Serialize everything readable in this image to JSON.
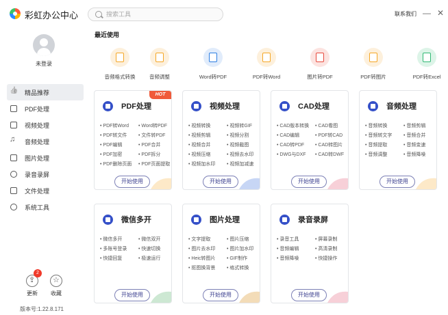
{
  "app": {
    "title": "彩虹办公中心"
  },
  "search": {
    "placeholder": "搜索工具"
  },
  "window": {
    "contact": "联系我们",
    "minimize": "—",
    "close": "✕"
  },
  "user": {
    "status": "未登录"
  },
  "sidebar": {
    "items": [
      {
        "label": "精品推荐",
        "icon": "thumbs-up-icon",
        "active": true
      },
      {
        "label": "PDF处理",
        "icon": "pdf-icon"
      },
      {
        "label": "视频处理",
        "icon": "video-icon"
      },
      {
        "label": "音频处理",
        "icon": "music-note-icon"
      },
      {
        "label": "图片处理",
        "icon": "image-icon"
      },
      {
        "label": "录音录屏",
        "icon": "record-icon"
      },
      {
        "label": "文件处理",
        "icon": "folder-icon"
      },
      {
        "label": "系统工具",
        "icon": "system-icon"
      }
    ],
    "update": {
      "label": "更新",
      "badge": "2"
    },
    "favorites": {
      "label": "收藏"
    },
    "version": "版本号:1.22.8.171"
  },
  "recent": {
    "title": "最近使用",
    "items": [
      {
        "label": "音频格式转换",
        "color": "#f5a623",
        "bg": "#fdf0dc"
      },
      {
        "label": "音频调整",
        "color": "#f5a623",
        "bg": "#fdf0dc"
      },
      {
        "label": "Word转PDF",
        "color": "#2a7de1",
        "bg": "#e1ecfb"
      },
      {
        "label": "PDF转Word",
        "color": "#f5a623",
        "bg": "#fdf0dc"
      },
      {
        "label": "图片转PDF",
        "color": "#e8473a",
        "bg": "#fce3e0"
      },
      {
        "label": "PDF转图片",
        "color": "#f5a623",
        "bg": "#fdf0dc"
      },
      {
        "label": "PDF转Excel",
        "color": "#2eb872",
        "bg": "#ddf4e8"
      }
    ]
  },
  "cards": [
    {
      "title": "PDF处理",
      "hot": "HOT",
      "color": "#3550c8",
      "features": [
        "PDF转Word",
        "Word转PDF",
        "PDF转文件",
        "文件转PDF",
        "PDF编辑",
        "PDF合并",
        "PDF加密",
        "PDF拆分",
        "PDF删除页面",
        "PDF页面提取"
      ],
      "button": "开始使用"
    },
    {
      "title": "视频处理",
      "color": "#3550c8",
      "features": [
        "视频转换",
        "视频转GIF",
        "视频剪辑",
        "视频分割",
        "视频合并",
        "视频截图",
        "视频压缩",
        "视频去水印",
        "视频加水印",
        "视频加减速"
      ],
      "button": "开始使用"
    },
    {
      "title": "CAD处理",
      "color": "#3550c8",
      "features": [
        "CAD版本转换",
        "CAD看图",
        "CAD编辑",
        "PDF转CAD",
        "CAD转PDF",
        "CAD转图片",
        "DWG与DXF",
        "CAD转DWF"
      ],
      "button": "开始使用"
    },
    {
      "title": "音频处理",
      "color": "#3550c8",
      "features": [
        "音频转换",
        "音频剪辑",
        "音频转文字",
        "音频合并",
        "音频提取",
        "音频变速",
        "音频调整",
        "音频降噪"
      ],
      "button": "开始使用"
    },
    {
      "title": "微信多开",
      "color": "#3550c8",
      "features": [
        "微信多开",
        "微信双开",
        "多账号登录",
        "快速切换",
        "快捷回复",
        "极速运行"
      ],
      "button": "开始使用"
    },
    {
      "title": "图片处理",
      "color": "#3550c8",
      "features": [
        "文字提取",
        "图片压缩",
        "图片去水印",
        "图片加水印",
        "Heic转图片",
        "GIF制作",
        "抠图换背景",
        "格式转换"
      ],
      "button": "开始使用"
    },
    {
      "title": "录音录屏",
      "color": "#3550c8",
      "features": [
        "录音工具",
        "屏幕录制",
        "音频编辑",
        "高清录制",
        "音频降噪",
        "快捷操作"
      ],
      "button": "开始使用"
    }
  ]
}
